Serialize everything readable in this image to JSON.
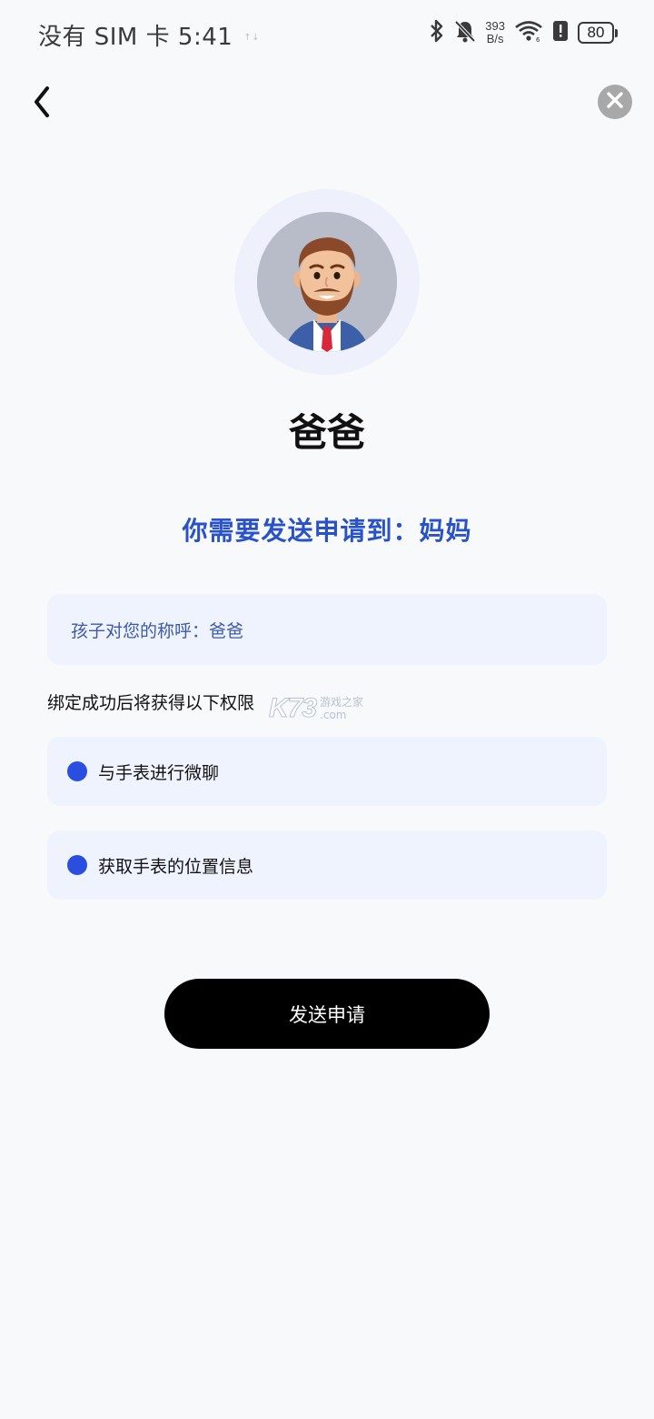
{
  "status_bar": {
    "carrier_time": "没有 SIM 卡 5:41",
    "tiny_mark": "↑↓",
    "net_speed_value": "393",
    "net_speed_unit": "B/s",
    "battery_level": "80"
  },
  "nav": {
    "back_icon": "chevron-left-icon",
    "close_icon": "close-circle-icon"
  },
  "profile": {
    "avatar_icon": "bearded-man-avatar",
    "role_name": "爸爸"
  },
  "request": {
    "send_to_text": "你需要发送申请到：妈妈"
  },
  "nickname": {
    "text": "孩子对您的称呼：爸爸"
  },
  "permissions": {
    "heading": "绑定成功后将获得以下权限",
    "items": [
      {
        "label": "与手表进行微聊"
      },
      {
        "label": "获取手表的位置信息"
      }
    ]
  },
  "watermark": {
    "logo": "K73",
    "line1": "游戏之家",
    "line2": ".com"
  },
  "actions": {
    "submit_label": "发送申请"
  },
  "colors": {
    "accent_blue": "#2a52c8",
    "dot_blue": "#2a4fe0",
    "card_bg": "#eef3fd",
    "button_bg": "#000000"
  }
}
